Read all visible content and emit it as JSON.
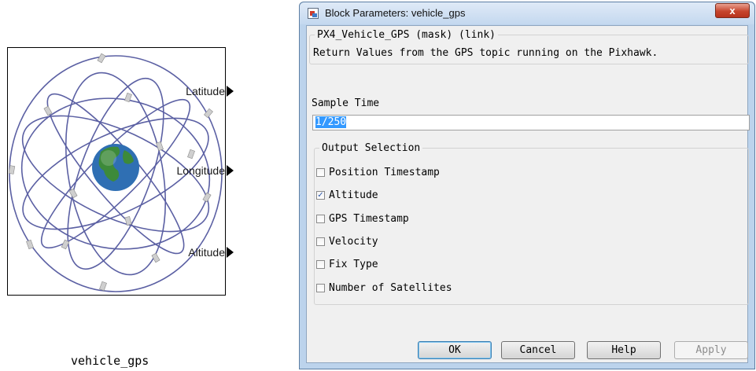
{
  "block": {
    "name": "vehicle_gps",
    "ports": [
      "Latitude",
      "Longitude",
      "Altitude"
    ]
  },
  "dialog": {
    "title": "Block Parameters: vehicle_gps",
    "close_glyph": "x",
    "mask_group_title": "PX4_Vehicle_GPS (mask) (link)",
    "description": "Return Values from the GPS topic running on the Pixhawk.",
    "sample_time_label": "Sample Time",
    "sample_time_value": "1/250",
    "output_group_title": "Output Selection",
    "outputs": [
      {
        "label": "Position Timestamp",
        "checked": false
      },
      {
        "label": "Altitude",
        "checked": true
      },
      {
        "label": "GPS Timestamp",
        "checked": false
      },
      {
        "label": "Velocity",
        "checked": false
      },
      {
        "label": "Fix Type",
        "checked": false
      },
      {
        "label": "Number of Satellites",
        "checked": false
      }
    ],
    "buttons": {
      "ok": "OK",
      "cancel": "Cancel",
      "help": "Help",
      "apply": "Apply"
    }
  },
  "colors": {
    "orbit": "#4a4f9a",
    "earth_ocean": "#2f6fb3",
    "earth_land": "#3d8a3a",
    "title_bar": "#c4d8ef",
    "close_button": "#c6452d"
  }
}
